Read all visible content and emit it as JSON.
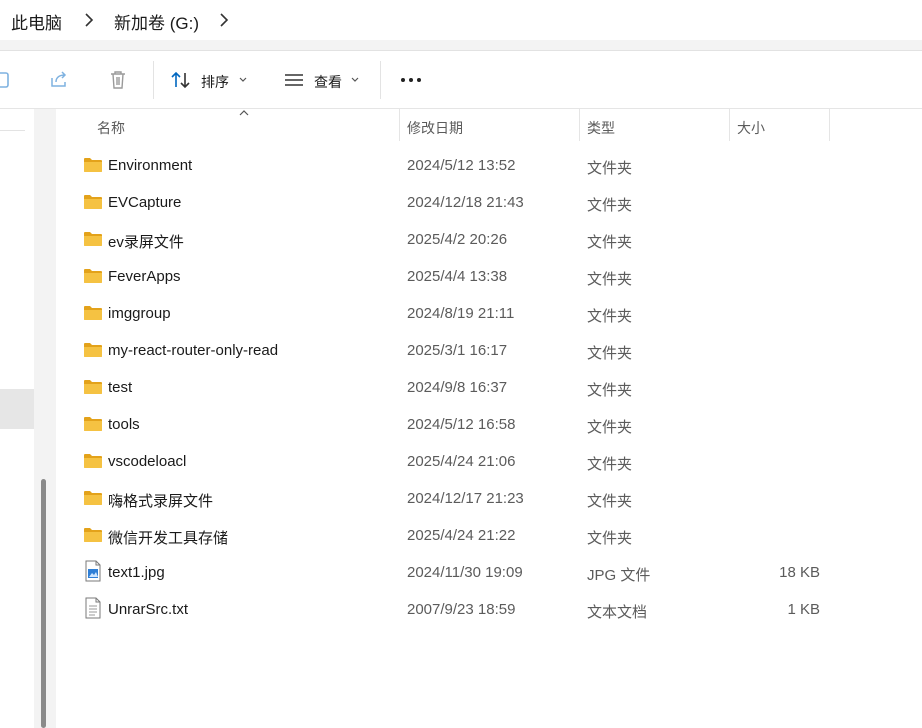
{
  "breadcrumb": {
    "items": [
      "此电脑",
      "新加卷 (G:)"
    ]
  },
  "toolbar": {
    "sort_label": "排序",
    "view_label": "查看",
    "more_label": "···",
    "icons": [
      "copy-icon",
      "share-icon",
      "delete-icon",
      "sort-icon",
      "view-icon",
      "more-icon"
    ]
  },
  "columns": {
    "name": "名称",
    "date": "修改日期",
    "type": "类型",
    "size": "大小",
    "sorted_by": "名称"
  },
  "files": [
    {
      "name": "Environment",
      "date": "2024/5/12 13:52",
      "type": "文件夹",
      "size": "",
      "icon": "folder-icon"
    },
    {
      "name": "EVCapture",
      "date": "2024/12/18 21:43",
      "type": "文件夹",
      "size": "",
      "icon": "folder-icon"
    },
    {
      "name": "ev录屏文件",
      "date": "2025/4/2 20:26",
      "type": "文件夹",
      "size": "",
      "icon": "folder-icon"
    },
    {
      "name": "FeverApps",
      "date": "2025/4/4 13:38",
      "type": "文件夹",
      "size": "",
      "icon": "folder-icon"
    },
    {
      "name": "imggroup",
      "date": "2024/8/19 21:11",
      "type": "文件夹",
      "size": "",
      "icon": "folder-icon"
    },
    {
      "name": "my-react-router-only-read",
      "date": "2025/3/1 16:17",
      "type": "文件夹",
      "size": "",
      "icon": "folder-icon"
    },
    {
      "name": "test",
      "date": "2024/9/8 16:37",
      "type": "文件夹",
      "size": "",
      "icon": "folder-icon"
    },
    {
      "name": "tools",
      "date": "2024/5/12 16:58",
      "type": "文件夹",
      "size": "",
      "icon": "folder-icon"
    },
    {
      "name": "vscodeloacl",
      "date": "2025/4/24 21:06",
      "type": "文件夹",
      "size": "",
      "icon": "folder-icon"
    },
    {
      "name": "嗨格式录屏文件",
      "date": "2024/12/17 21:23",
      "type": "文件夹",
      "size": "",
      "icon": "folder-icon"
    },
    {
      "name": "微信开发工具存储",
      "date": "2025/4/24 21:22",
      "type": "文件夹",
      "size": "",
      "icon": "folder-icon"
    },
    {
      "name": "text1.jpg",
      "date": "2024/11/30 19:09",
      "type": "JPG 文件",
      "size": "18 KB",
      "icon": "image-file-icon"
    },
    {
      "name": "UnrarSrc.txt",
      "date": "2007/9/23 18:59",
      "type": "文本文档",
      "size": "1 KB",
      "icon": "text-file-icon"
    }
  ],
  "colors": {
    "folder": "#f5c242",
    "folder_dark": "#e3a21a",
    "accent": "#0067c0",
    "text_primary": "#1a1a1a",
    "text_secondary": "#5b5b5b"
  }
}
